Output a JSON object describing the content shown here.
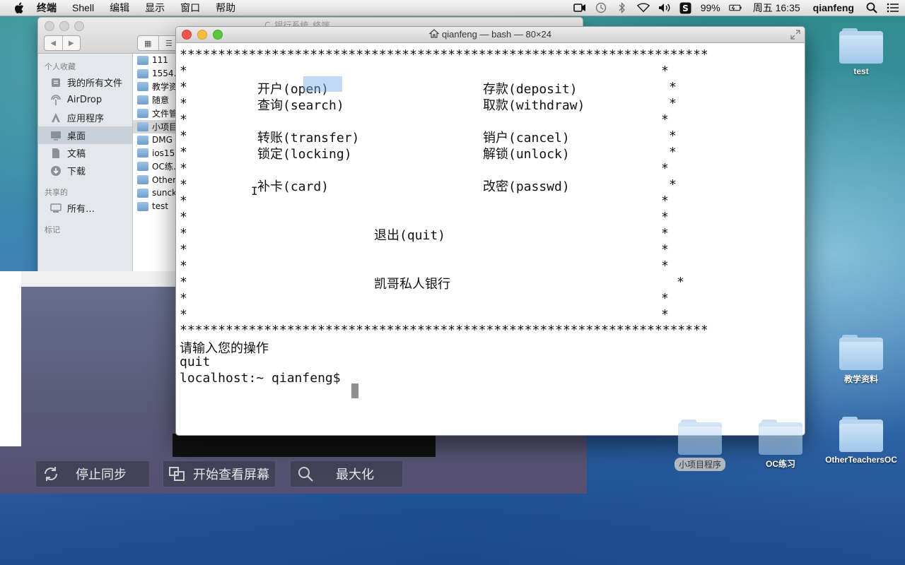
{
  "menubar": {
    "items": [
      "终端",
      "Shell",
      "编辑",
      "显示",
      "窗口",
      "帮助"
    ],
    "battery": "99%",
    "clock": "周五 16:35",
    "user": "qianfeng",
    "icons": [
      "apple-icon",
      "camera-icon",
      "time-machine-icon",
      "bluetooth-icon",
      "wifi-icon",
      "volume-icon",
      "s-app-icon",
      "battery-icon",
      "search-icon",
      "list-icon"
    ]
  },
  "finder": {
    "title": "C_银行系统_终端",
    "sidebar": {
      "section_favorites": "个人收藏",
      "favorites": [
        "我的所有文件",
        "AirDrop",
        "应用程序",
        "桌面",
        "文稿",
        "下载"
      ],
      "selected_index": 3,
      "section_shared": "共享的",
      "shared": [
        "所有…"
      ],
      "section_tags": "标记"
    },
    "files": [
      "111",
      "1554…",
      "教学资…",
      "随意",
      "文件管…",
      "小项目…",
      "DMG",
      "ios15…",
      "OC练…",
      "Other…",
      "sunck…",
      "test"
    ],
    "selected_file_index": 5
  },
  "terminal": {
    "title": "qianfeng — bash — 80×24",
    "border": "*********************************************************************",
    "star": "*",
    "menu": {
      "open": "开户(open)",
      "deposit": "存款(deposit)",
      "search": "查询(search)",
      "withdraw": "取款(withdraw)",
      "transfer": "转账(transfer)",
      "cancel": "销户(cancel)",
      "locking": "锁定(locking)",
      "unlock": "解锁(unlock)",
      "card": "补卡(card)",
      "passwd": "改密(passwd)",
      "quit": "退出(quit)",
      "bank_name": "凯哥私人银行"
    },
    "prompt_label": "请输入您的操作",
    "typed": "quit",
    "shell_prompt": "localhost:~ qianfeng$"
  },
  "recorder": {
    "stop_sync": "停止同步",
    "start_view": "开始查看屏幕",
    "maximize": "最大化"
  },
  "desktop": {
    "icons": [
      "test",
      "教学资料",
      "小项目程序",
      "OC练习",
      "OtherTeachersOC"
    ]
  }
}
